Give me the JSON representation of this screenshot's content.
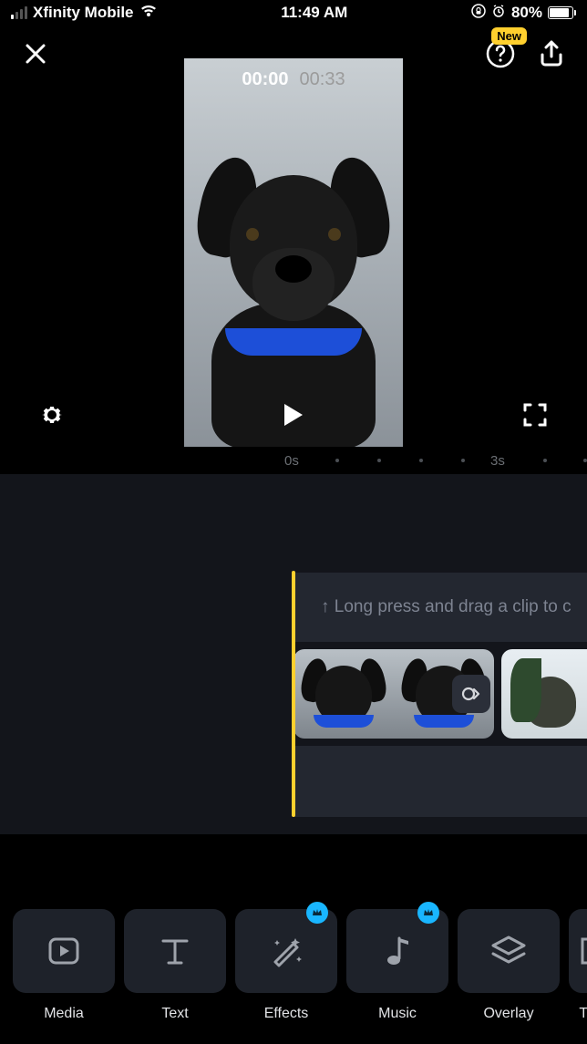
{
  "status": {
    "carrier": "Xfinity Mobile",
    "time": "11:49 AM",
    "battery_percent": "80%"
  },
  "topbar": {
    "new_badge": "New"
  },
  "preview": {
    "time_current": "00:00",
    "time_total": "00:33"
  },
  "ruler": {
    "marks": [
      "0s",
      "3s"
    ]
  },
  "timeline": {
    "hint": "↑ Long press and drag a clip to c"
  },
  "toolbar": {
    "items": [
      {
        "label": "Media",
        "premium": false
      },
      {
        "label": "Text",
        "premium": false
      },
      {
        "label": "Effects",
        "premium": true
      },
      {
        "label": "Music",
        "premium": true
      },
      {
        "label": "Overlay",
        "premium": false
      },
      {
        "label": "Tit",
        "premium": false
      }
    ]
  }
}
